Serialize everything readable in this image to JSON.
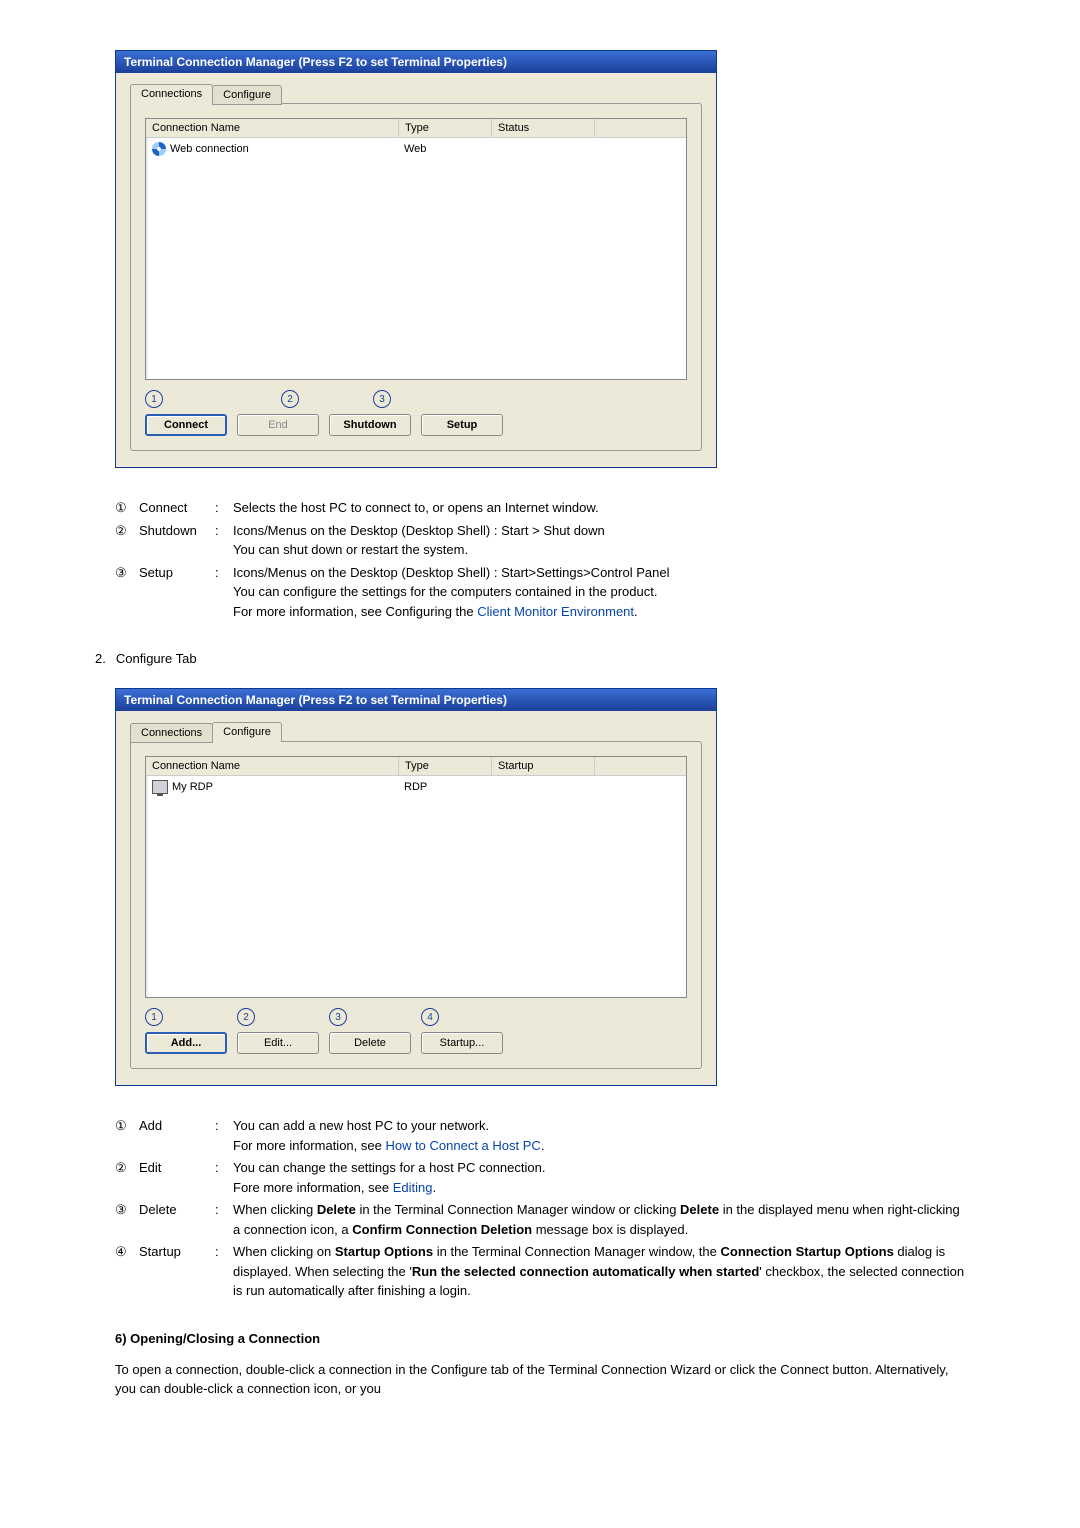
{
  "dialog1": {
    "title": "Terminal Connection Manager (Press F2 to set Terminal Properties)",
    "tabs": {
      "connections": "Connections",
      "configure": "Configure",
      "active": "Connections"
    },
    "cols": {
      "name": "Connection Name",
      "type": "Type",
      "status": "Status"
    },
    "row": {
      "name": "Web connection",
      "type": "Web",
      "status": ""
    },
    "buttons": {
      "connect": "Connect",
      "end": "End",
      "shutdown": "Shutdown",
      "setup": "Setup"
    },
    "callouts": [
      "1",
      "2",
      "3"
    ]
  },
  "expl1": {
    "n1": "①",
    "l1": "Connect",
    "t1a": "Selects the host PC to connect to, or opens an Internet window.",
    "n2": "②",
    "l2": "Shutdown",
    "t2a": "Icons/Menus on the Desktop (Desktop Shell) : Start > Shut down",
    "t2b": "You can shut down or restart the system.",
    "n3": "③",
    "l3": "Setup",
    "t3a": "Icons/Menus on the Desktop (Desktop Shell) : Start>Settings>Control Panel",
    "t3b": "You can configure the settings for the computers contained in the product.",
    "t3c_pre": "For more information, see Configuring the ",
    "t3c_link": "Client Monitor Environment",
    "t3c_post": "."
  },
  "section2": {
    "num": "2.",
    "title": "Configure Tab"
  },
  "dialog2": {
    "title": "Terminal Connection Manager (Press F2 to set Terminal Properties)",
    "tabs": {
      "connections": "Connections",
      "configure": "Configure",
      "active": "Configure"
    },
    "cols": {
      "name": "Connection Name",
      "type": "Type",
      "startup": "Startup"
    },
    "row": {
      "name": "My RDP",
      "type": "RDP",
      "startup": ""
    },
    "buttons": {
      "add": "Add...",
      "edit": "Edit...",
      "delete": "Delete",
      "startup": "Startup..."
    },
    "callouts": [
      "1",
      "2",
      "3",
      "4"
    ]
  },
  "expl2": {
    "n1": "①",
    "l1": "Add",
    "t1a": "You can add a new host PC to your network.",
    "t1b_pre": "For more information, see ",
    "t1b_link": "How to Connect a Host PC",
    "t1b_post": ".",
    "n2": "②",
    "l2": "Edit",
    "t2a": "You can change the settings for a host PC connection.",
    "t2b_pre": "Fore more information, see ",
    "t2b_link": "Editing",
    "t2b_post": ".",
    "n3": "③",
    "l3": "Delete",
    "t3a_pre": "When clicking ",
    "t3a_b1": "Delete",
    "t3a_mid": " in the Terminal Connection Manager window or clicking ",
    "t3b_b1": "Delete",
    "t3b_mid": " in the displayed menu when right-clicking a connection icon, a ",
    "t3b_b2": "Confirm Connection Deletion",
    "t3b_post": " message box is displayed.",
    "n4": "④",
    "l4": "Startup",
    "t4a_pre": "When clicking on ",
    "t4a_b1": "Startup Options",
    "t4a_mid": " in the Terminal Connection Manager window, the ",
    "t4a_b2": "Connection Startup Options",
    "t4a_mid2": " dialog is displayed. When selecting the '",
    "t4a_b3": "Run the selected connection automatically when started",
    "t4a_post": "' checkbox, the selected connection is run automatically after finishing a login."
  },
  "heading6": "6) Opening/Closing a Connection",
  "para": "To open a connection, double-click a connection in the Configure tab of the Terminal Connection Wizard or click the Connect button. Alternatively, you can double-click a connection icon, or you"
}
